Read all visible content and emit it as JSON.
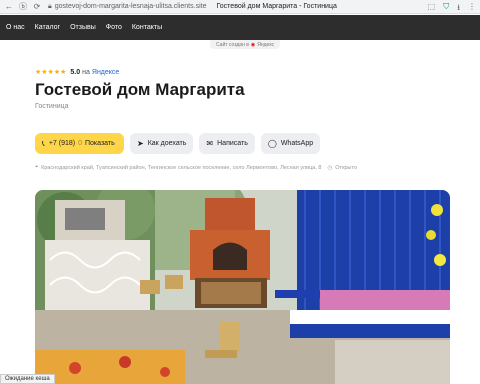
{
  "browser": {
    "url": "gostevoj-dom-margarita-lesnaja-ulitsa.clients.site",
    "tab_title": "Гостевой дом Маргарита - Гостиница",
    "status_text": "Ожидание кеша"
  },
  "nav": {
    "items": [
      {
        "label": "О нас"
      },
      {
        "label": "Каталог"
      },
      {
        "label": "Отзывы"
      },
      {
        "label": "Фото"
      },
      {
        "label": "Контакты"
      }
    ]
  },
  "created": {
    "text": "Сайт создан в",
    "brand": "Яндекс"
  },
  "rating": {
    "stars": "★★★★★",
    "value": "5.0",
    "on": "на",
    "source": "Яндексе",
    "star_color": "#f5b300"
  },
  "header": {
    "title": "Гостевой дом Маргарита",
    "subtitle": "Гостиница"
  },
  "actions": {
    "phone_prefix": "+7 (918)",
    "phone_masked": "0",
    "phone_show": "Показать",
    "directions": "Как доехать",
    "message": "Написать",
    "whatsapp": "WhatsApp",
    "accent": "#ffd54a"
  },
  "address": {
    "text": "Краснодарский край, Туапсинский район, Тенгинское сельское поселение, село Лермонтово, Лесная улица, 8",
    "status": "Открыто"
  }
}
